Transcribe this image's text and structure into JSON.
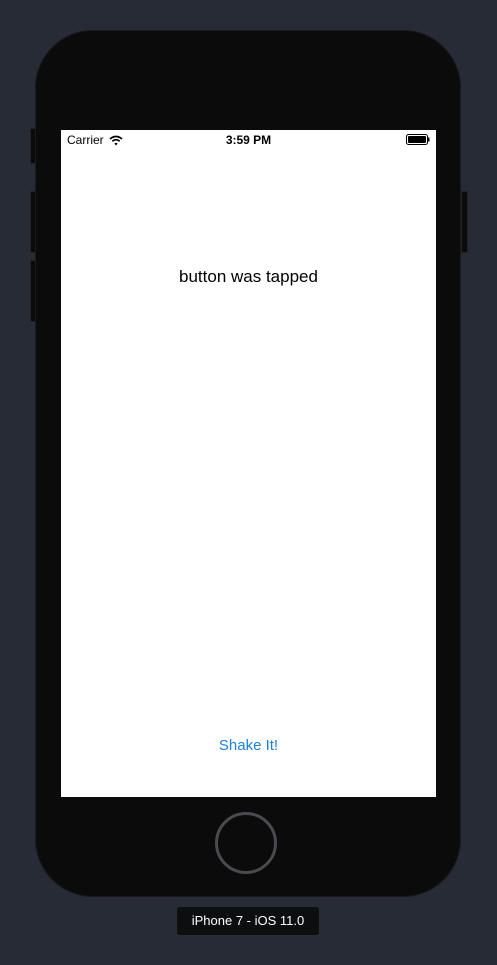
{
  "status_bar": {
    "carrier": "Carrier",
    "time": "3:59 PM",
    "wifi_icon": "wifi-icon",
    "battery_icon": "battery-full-icon"
  },
  "screen": {
    "message": "button was tapped",
    "shake_button_label": "Shake It!"
  },
  "simulator": {
    "device_label": "iPhone 7 - iOS 11.0"
  },
  "colors": {
    "background": "#262b35",
    "device_body": "#0b0b0c",
    "accent": "#1a82e2"
  }
}
